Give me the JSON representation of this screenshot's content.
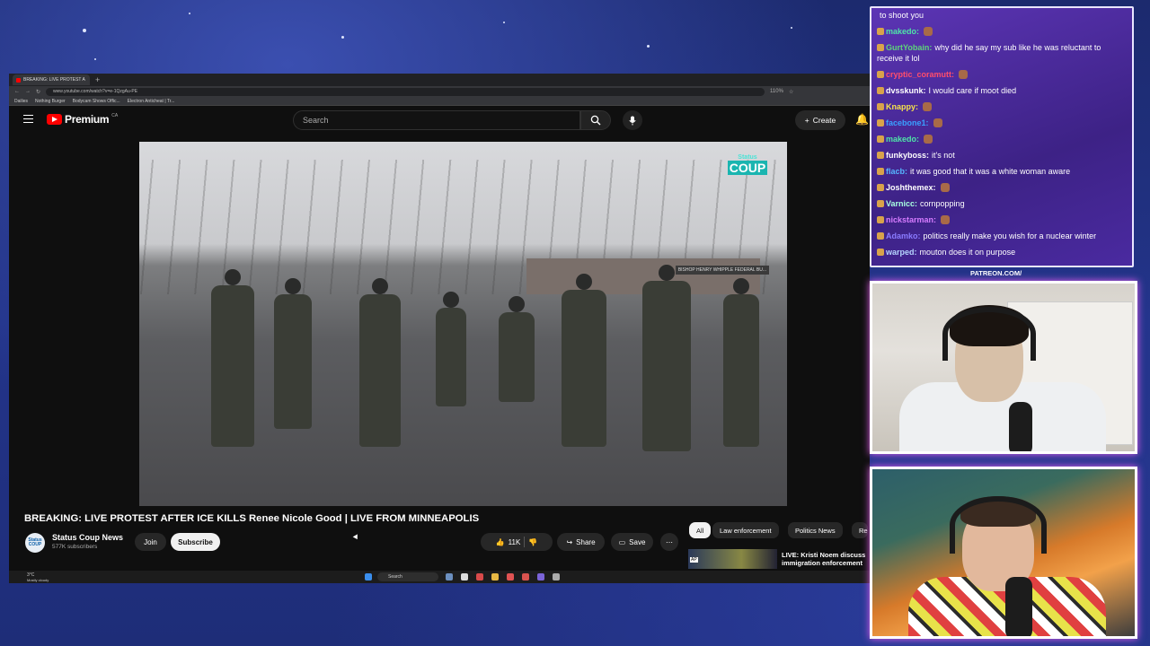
{
  "browser": {
    "tab_title": "BREAKING: LIVE PROTEST A",
    "url": "www.youtube.com/watch?v=e-1QzgAu-PE",
    "zoom": "110%",
    "bookmarks": [
      "Dailies",
      "Nothing Burger",
      "Bodycam Shows Offic...",
      "Electron Anticheat | Tr..."
    ]
  },
  "youtube": {
    "logo_text": "Premium",
    "region": "CA",
    "search_placeholder": "Search",
    "create_label": "Create",
    "video_title": "BREAKING: LIVE PROTEST AFTER ICE KILLS Renee Nicole Good | LIVE FROM MINNEAPOLIS",
    "channel_name": "Status Coup News",
    "channel_subs": "577K subscribers",
    "channel_avatar_text": "Status COUP",
    "join_label": "Join",
    "subscribe_label": "Subscribe",
    "likes": "11K",
    "share_label": "Share",
    "save_label": "Save",
    "watermark_small": "Status",
    "watermark_big": "COUP",
    "sign_text": "BISHOP HENRY WHIPPLE FEDERAL BU...",
    "chips": [
      "All",
      "Law enforcement",
      "Politics News",
      "Re"
    ],
    "rec_title": "LIVE: Kristi Noem discuss immigration enforcement",
    "rec_badge": "AP"
  },
  "taskbar": {
    "weather": "3°C",
    "weather_desc": "Mostly cloudy",
    "search_label": "Search"
  },
  "chat": {
    "messages": [
      {
        "user": "",
        "text": "to shoot you",
        "color": "#ffffff"
      },
      {
        "user": "makedo:",
        "text": "",
        "color": "#4ee6a8"
      },
      {
        "user": "GurtYobain:",
        "text": "why did he say my sub like he was reluctant to receive it lol",
        "color": "#5ed47a"
      },
      {
        "user": "cryptic_coramutt:",
        "text": "",
        "color": "#ff4d6d"
      },
      {
        "user": "dvsskunk:",
        "text": "I would care if moot died",
        "color": "#ffffff"
      },
      {
        "user": "Knappy:",
        "text": "",
        "color": "#f6e24b"
      },
      {
        "user": "facebone1:",
        "text": "",
        "color": "#3aa0ff"
      },
      {
        "user": "makedo:",
        "text": "",
        "color": "#4ee6a8"
      },
      {
        "user": "funkyboss:",
        "text": "it's not",
        "color": "#ffffff"
      },
      {
        "user": "flacb:",
        "text": "it was good that it was a white woman aware",
        "color": "#56b6ff"
      },
      {
        "user": "Joshthemex:",
        "text": "",
        "color": "#ffffff"
      },
      {
        "user": "Varnicc:",
        "text": "cornpopping",
        "color": "#a8ffe0"
      },
      {
        "user": "nickstarman:",
        "text": "",
        "color": "#d67cff"
      },
      {
        "user": "Adamko:",
        "text": "politics really make you wish for a nuclear winter",
        "color": "#8a7cff"
      },
      {
        "user": "warped:",
        "text": "mouton does it on purpose",
        "color": "#b7d6ff"
      }
    ]
  },
  "overlay": {
    "patreon": "PATREON.COM/",
    "script_logo": "Asymmetric"
  }
}
